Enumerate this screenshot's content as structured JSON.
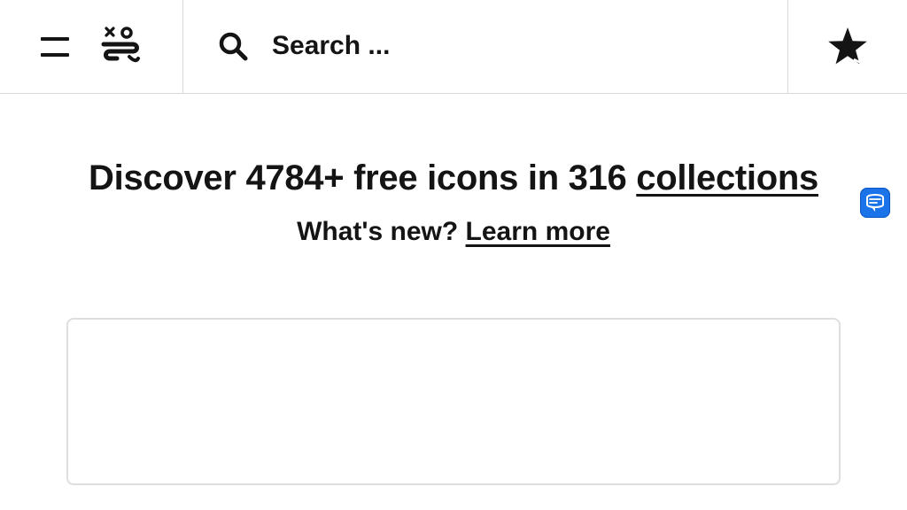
{
  "header": {
    "menu_icon": "menu-icon",
    "logo_icon": "icon-sets-logo-icon",
    "search": {
      "icon": "search-icon",
      "placeholder": "Search ...",
      "value": ""
    },
    "favorites_icon": "star-icon"
  },
  "hero": {
    "title_prefix": "Discover 4784+ free icons in 316 ",
    "title_link": "collections",
    "subtitle_prefix": "What's new? ",
    "subtitle_link": "Learn more"
  },
  "extension_badge_icon": "translate-extension-icon",
  "colors": {
    "text": "#141414",
    "border": "#d9d9d9",
    "badge": "#1a73e8",
    "background": "#ffffff"
  }
}
